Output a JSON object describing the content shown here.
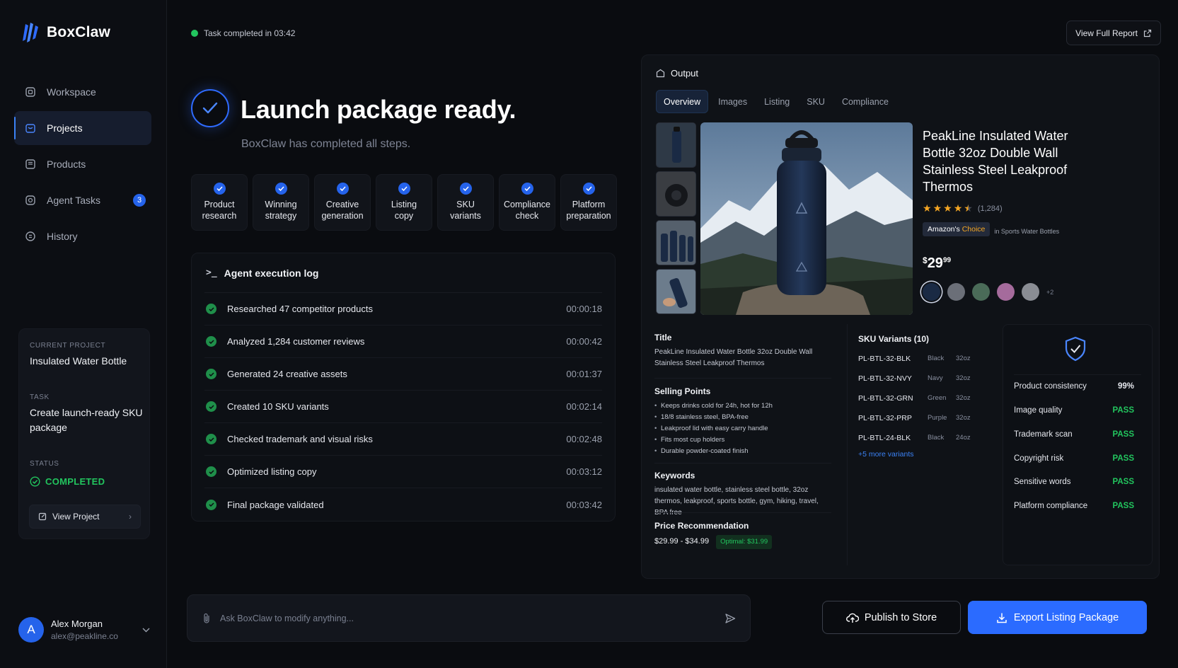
{
  "brand": {
    "name": "BoxClaw"
  },
  "sidebar": {
    "items": [
      {
        "label": "Workspace",
        "icon": "workspace-icon",
        "active": false
      },
      {
        "label": "Projects",
        "icon": "projects-icon",
        "active": true
      },
      {
        "label": "Products",
        "icon": "products-icon",
        "active": false
      },
      {
        "label": "Agent Tasks",
        "icon": "agent-tasks-icon",
        "active": false,
        "badge": "3"
      },
      {
        "label": "History",
        "icon": "history-icon",
        "active": false
      }
    ],
    "project_card": {
      "current_project_label": "CURRENT PROJECT",
      "current_project_value": "Insulated Water Bottle",
      "task_label": "TASK",
      "task_value": "Create launch-ready SKU package",
      "status_label": "STATUS",
      "status_value": "COMPLETED",
      "view_button": "View Project"
    },
    "user": {
      "initial": "A",
      "name": "Alex Morgan",
      "email": "alex@peakline.co"
    }
  },
  "header": {
    "task_status": "Task completed in 03:42",
    "view_report": "View Full Report"
  },
  "hero": {
    "title": "Launch package ready.",
    "subtitle": "BoxClaw has completed all steps."
  },
  "steps": [
    {
      "line1": "Product",
      "line2": "research"
    },
    {
      "line1": "Winning",
      "line2": "strategy"
    },
    {
      "line1": "Creative",
      "line2": "generation"
    },
    {
      "line1": "Listing",
      "line2": "copy"
    },
    {
      "line1": "SKU",
      "line2": "variants"
    },
    {
      "line1": "Compliance",
      "line2": "check"
    },
    {
      "line1": "Platform",
      "line2": "preparation"
    }
  ],
  "log": {
    "title": "Agent execution log",
    "rows": [
      {
        "text": "Researched 47 competitor products",
        "time": "00:00:18"
      },
      {
        "text": "Analyzed 1,284 customer reviews",
        "time": "00:00:42"
      },
      {
        "text": "Generated 24 creative assets",
        "time": "00:01:37"
      },
      {
        "text": "Created 10 SKU variants",
        "time": "00:02:14"
      },
      {
        "text": "Checked trademark and visual risks",
        "time": "00:02:48"
      },
      {
        "text": "Optimized listing copy",
        "time": "00:03:12"
      },
      {
        "text": "Final package validated",
        "time": "00:03:42"
      }
    ]
  },
  "output": {
    "title": "Output",
    "tabs": [
      "Overview",
      "Images",
      "Listing",
      "SKU",
      "Compliance"
    ],
    "active_tab": "Overview",
    "product": {
      "title": "PeakLine Insulated Water Bottle 32oz Double Wall Stainless Steel Leakproof Thermos",
      "rating_count": "(1,284)",
      "rating": 4.5,
      "badge_prefix": "Amazon's ",
      "badge_suffix": "Choice",
      "badge_category": "in Sports Water Bottles",
      "price_currency": "$",
      "price_whole": "29",
      "price_cents": "99",
      "swatch_colors": [
        "#1a2a44",
        "#6b6f78",
        "#4a6b58",
        "#a56b9c",
        "#8a8d94"
      ],
      "swatch_more": "+2"
    },
    "details": {
      "title_heading": "Title",
      "title_text": "PeakLine Insulated Water Bottle 32oz Double Wall Stainless Steel Leakproof Thermos",
      "selling_heading": "Selling Points",
      "selling_points": [
        "Keeps drinks cold for 24h, hot for 12h",
        "18/8 stainless steel, BPA-free",
        "Leakproof lid with easy carry handle",
        "Fits most cup holders",
        "Durable powder-coated finish"
      ],
      "keywords_heading": "Keywords",
      "keywords_text": "insulated water bottle, stainless steel bottle, 32oz thermos, leakproof, sports bottle, gym, hiking, travel, BPA free",
      "price_heading": "Price Recommendation",
      "price_range": "$29.99 - $34.99",
      "price_optimal": "Optimal: $31.99"
    },
    "sku": {
      "heading": "SKU Variants (10)",
      "rows": [
        {
          "code": "PL-BTL-32-BLK",
          "color": "Black",
          "size": "32oz"
        },
        {
          "code": "PL-BTL-32-NVY",
          "color": "Navy",
          "size": "32oz"
        },
        {
          "code": "PL-BTL-32-GRN",
          "color": "Green",
          "size": "32oz"
        },
        {
          "code": "PL-BTL-32-PRP",
          "color": "Purple",
          "size": "32oz"
        },
        {
          "code": "PL-BTL-24-BLK",
          "color": "Black",
          "size": "24oz"
        }
      ],
      "more": "+5 more variants"
    },
    "checks": [
      {
        "label": "Product consistency",
        "value": "99%"
      },
      {
        "label": "Image quality",
        "value": "PASS"
      },
      {
        "label": "Trademark scan",
        "value": "PASS"
      },
      {
        "label": "Copyright risk",
        "value": "PASS"
      },
      {
        "label": "Sensitive words",
        "value": "PASS"
      },
      {
        "label": "Platform compliance",
        "value": "PASS"
      }
    ]
  },
  "chat": {
    "placeholder": "Ask BoxClaw to modify anything..."
  },
  "actions": {
    "publish": "Publish to Store",
    "export": "Export Listing Package"
  },
  "colors": {
    "accent": "#2b6bff",
    "success": "#22c55e",
    "background": "#0a0c10"
  }
}
